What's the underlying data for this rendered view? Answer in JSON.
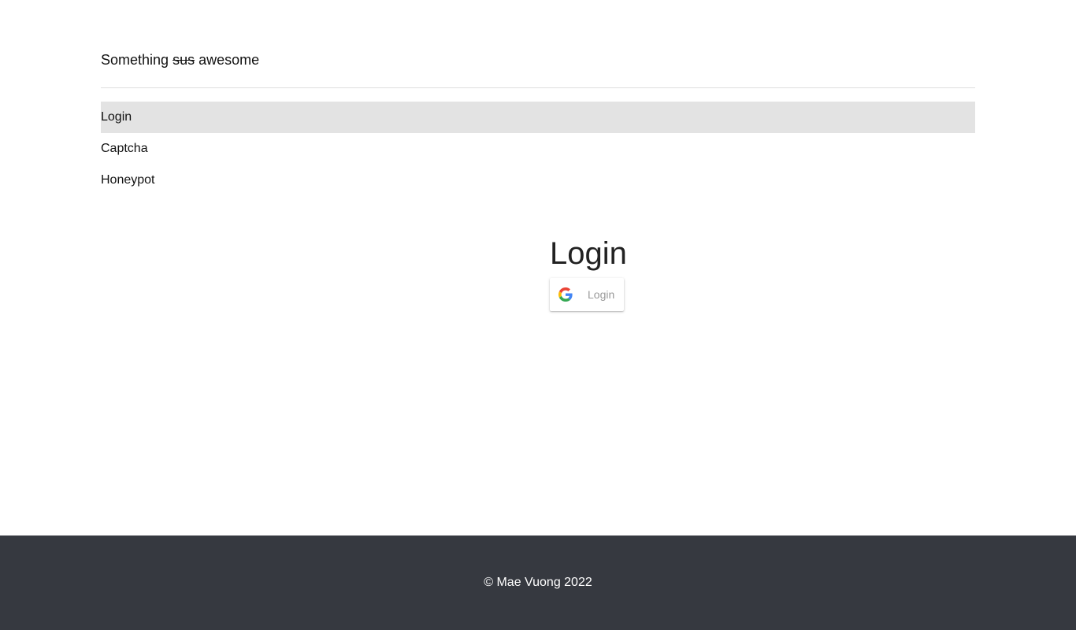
{
  "header": {
    "brand_prefix": "Something",
    "brand_strikethrough": "sus",
    "brand_suffix": "awesome"
  },
  "nav": {
    "items": [
      {
        "label": "Login",
        "active": true
      },
      {
        "label": "Captcha",
        "active": false
      },
      {
        "label": "Honeypot",
        "active": false
      }
    ]
  },
  "main": {
    "title": "Login",
    "google_button_label": "Login",
    "google_button_icon": "google-icon"
  },
  "footer": {
    "copyright": "© Mae Vuong 2022"
  },
  "colors": {
    "active_nav_bg": "#e3e3e3",
    "footer_bg": "#363940",
    "button_text": "#999999"
  }
}
